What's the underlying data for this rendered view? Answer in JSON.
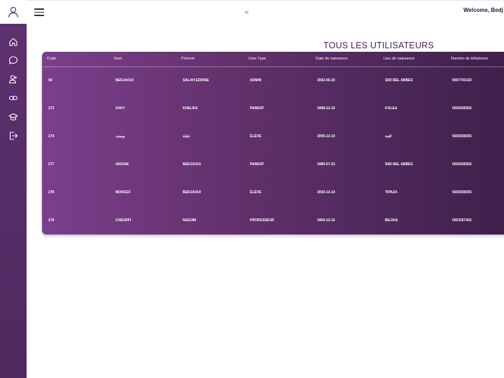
{
  "header": {
    "back_label": "<",
    "welcome_text": "Welcome, Bedj"
  },
  "page": {
    "title": "TOUS LES UTILISATEURS"
  },
  "sidebar": {
    "items": [
      {
        "icon": "home-icon"
      },
      {
        "icon": "chat-icon"
      },
      {
        "icon": "user-icon"
      },
      {
        "icon": "link-icon"
      },
      {
        "icon": "graduation-cap-icon"
      },
      {
        "icon": "logout-icon"
      }
    ]
  },
  "table": {
    "columns": [
      "Code",
      "Nom",
      "Prénom",
      "User Type",
      "Date de naissance",
      "Lieu de naissance",
      "Numéro de téléphone"
    ],
    "rows": [
      [
        "58",
        "BEDJAOUI",
        "SALAH EDDINE",
        "ADMIN",
        "2002-06-19",
        "SIDI BEL ABBES",
        "0557743163"
      ],
      [
        "273",
        "ZAKY",
        "KHELIFA",
        "PARENT",
        "1998-12-19",
        "KOLEA",
        "5555555555"
      ],
      [
        "274",
        "يوسف",
        "خليلة",
        "ÉLÈVE",
        "2005-12-19",
        "القبة",
        "5555555555"
      ],
      [
        "277",
        "AKRAM",
        "BEDJAOUI",
        "PARENT",
        "1995-07-23",
        "SIDI BEL ABBES",
        "5555555555"
      ],
      [
        "278",
        "MONCEF",
        "BEDJAOUI",
        "ÉLÈVE",
        "2030-12-14",
        "TIPAZA",
        "5555555555"
      ],
      [
        "279",
        "CHEURFI",
        "NADJIM",
        "PROFESSEUR",
        "1969-12-15",
        "BEJAIA",
        "0553267422"
      ]
    ]
  },
  "colors": {
    "sidebar": "#5e3170",
    "table_start": "#7b3f8d",
    "table_end": "#3d1f49",
    "title": "#4a2460"
  }
}
